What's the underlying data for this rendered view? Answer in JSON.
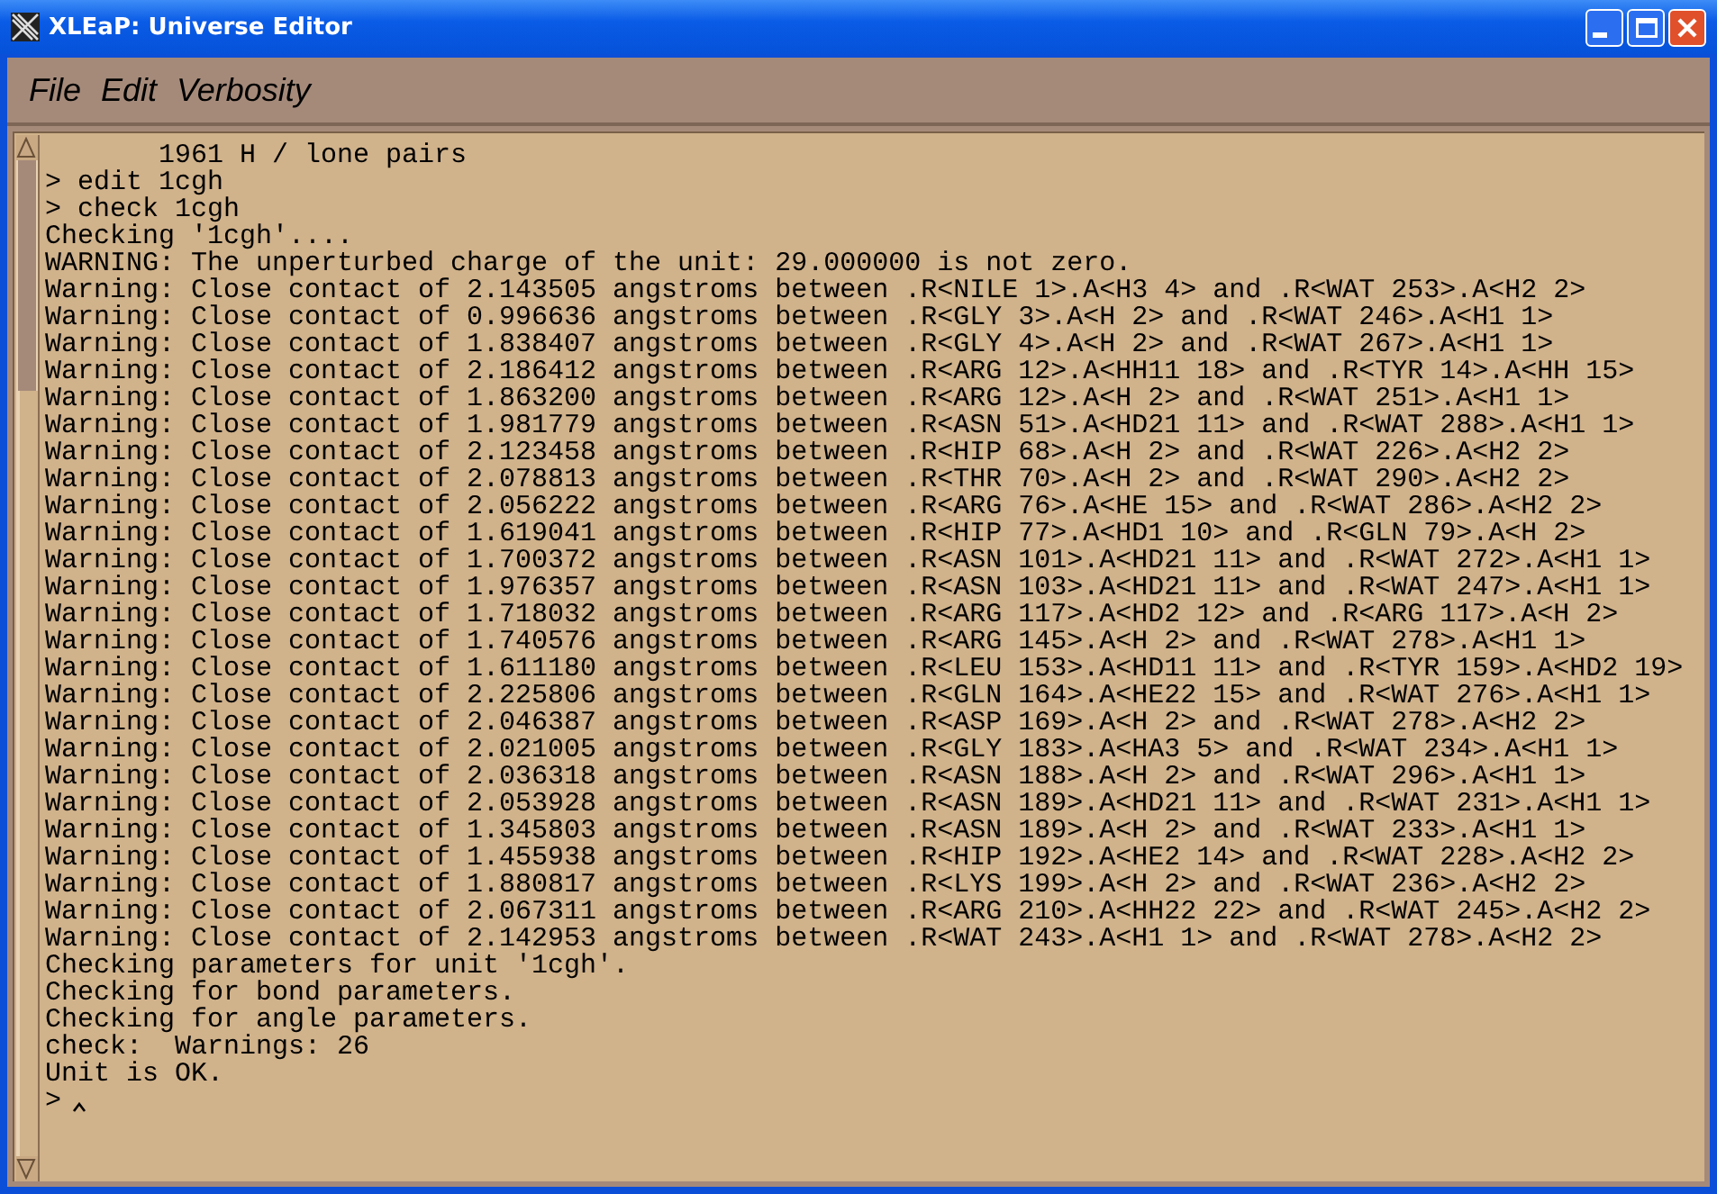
{
  "window": {
    "title": "XLEaP: Universe Editor"
  },
  "menu": [
    "File",
    "Edit",
    "Verbosity"
  ],
  "console": {
    "lines": [
      "       1961 H / lone pairs",
      "> edit 1cgh",
      "> check 1cgh",
      "Checking '1cgh'....",
      "WARNING: The unperturbed charge of the unit: 29.000000 is not zero.",
      "Warning: Close contact of 2.143505 angstroms between .R<NILE 1>.A<H3 4> and .R<WAT 253>.A<H2 2>",
      "Warning: Close contact of 0.996636 angstroms between .R<GLY 3>.A<H 2> and .R<WAT 246>.A<H1 1>",
      "Warning: Close contact of 1.838407 angstroms between .R<GLY 4>.A<H 2> and .R<WAT 267>.A<H1 1>",
      "Warning: Close contact of 2.186412 angstroms between .R<ARG 12>.A<HH11 18> and .R<TYR 14>.A<HH 15>",
      "Warning: Close contact of 1.863200 angstroms between .R<ARG 12>.A<H 2> and .R<WAT 251>.A<H1 1>",
      "Warning: Close contact of 1.981779 angstroms between .R<ASN 51>.A<HD21 11> and .R<WAT 288>.A<H1 1>",
      "Warning: Close contact of 2.123458 angstroms between .R<HIP 68>.A<H 2> and .R<WAT 226>.A<H2 2>",
      "Warning: Close contact of 2.078813 angstroms between .R<THR 70>.A<H 2> and .R<WAT 290>.A<H2 2>",
      "Warning: Close contact of 2.056222 angstroms between .R<ARG 76>.A<HE 15> and .R<WAT 286>.A<H2 2>",
      "Warning: Close contact of 1.619041 angstroms between .R<HIP 77>.A<HD1 10> and .R<GLN 79>.A<H 2>",
      "Warning: Close contact of 1.700372 angstroms between .R<ASN 101>.A<HD21 11> and .R<WAT 272>.A<H1 1>",
      "Warning: Close contact of 1.976357 angstroms between .R<ASN 103>.A<HD21 11> and .R<WAT 247>.A<H1 1>",
      "Warning: Close contact of 1.718032 angstroms between .R<ARG 117>.A<HD2 12> and .R<ARG 117>.A<H 2>",
      "Warning: Close contact of 1.740576 angstroms between .R<ARG 145>.A<H 2> and .R<WAT 278>.A<H1 1>",
      "Warning: Close contact of 1.611180 angstroms between .R<LEU 153>.A<HD11 11> and .R<TYR 159>.A<HD2 19>",
      "Warning: Close contact of 2.225806 angstroms between .R<GLN 164>.A<HE22 15> and .R<WAT 276>.A<H1 1>",
      "Warning: Close contact of 2.046387 angstroms between .R<ASP 169>.A<H 2> and .R<WAT 278>.A<H2 2>",
      "Warning: Close contact of 2.021005 angstroms between .R<GLY 183>.A<HA3 5> and .R<WAT 234>.A<H1 1>",
      "Warning: Close contact of 2.036318 angstroms between .R<ASN 188>.A<H 2> and .R<WAT 296>.A<H1 1>",
      "Warning: Close contact of 2.053928 angstroms between .R<ASN 189>.A<HD21 11> and .R<WAT 231>.A<H1 1>",
      "Warning: Close contact of 1.345803 angstroms between .R<ASN 189>.A<H 2> and .R<WAT 233>.A<H1 1>",
      "Warning: Close contact of 1.455938 angstroms between .R<HIP 192>.A<HE2 14> and .R<WAT 228>.A<H2 2>",
      "Warning: Close contact of 1.880817 angstroms between .R<LYS 199>.A<H 2> and .R<WAT 236>.A<H2 2>",
      "Warning: Close contact of 2.067311 angstroms between .R<ARG 210>.A<HH22 22> and .R<WAT 245>.A<H2 2>",
      "Warning: Close contact of 2.142953 angstroms between .R<WAT 243>.A<H1 1> and .R<WAT 278>.A<H2 2>",
      "Checking parameters for unit '1cgh'.",
      "Checking for bond parameters.",
      "Checking for angle parameters.",
      "check:  Warnings: 26",
      "Unit is OK."
    ],
    "prompt": ">"
  }
}
